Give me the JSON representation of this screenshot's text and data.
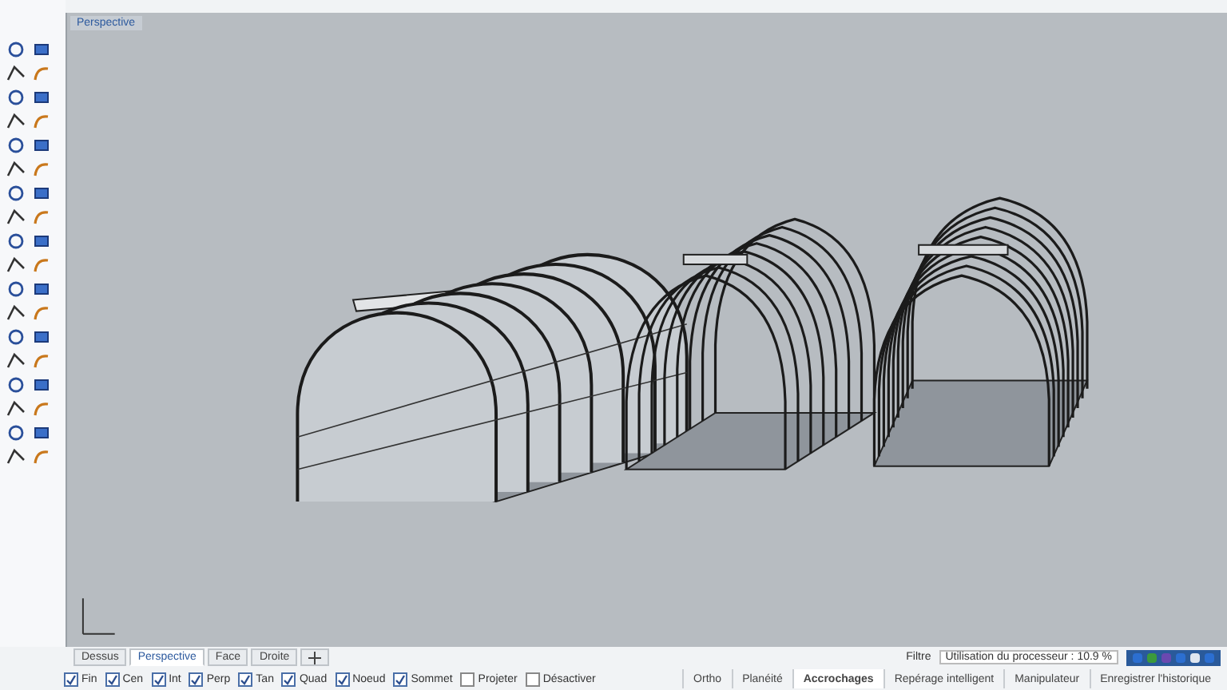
{
  "viewport": {
    "title": "Perspective"
  },
  "view_tabs": [
    {
      "label": "Dessus",
      "selected": false
    },
    {
      "label": "Perspective",
      "selected": true
    },
    {
      "label": "Face",
      "selected": false
    },
    {
      "label": "Droite",
      "selected": false
    }
  ],
  "osnaps": [
    {
      "label": "Fin",
      "checked": true
    },
    {
      "label": "Cen",
      "checked": true
    },
    {
      "label": "Int",
      "checked": true
    },
    {
      "label": "Perp",
      "checked": true
    },
    {
      "label": "Tan",
      "checked": true
    },
    {
      "label": "Quad",
      "checked": true
    },
    {
      "label": "Noeud",
      "checked": true
    },
    {
      "label": "Sommet",
      "checked": true
    },
    {
      "label": "Projeter",
      "checked": false
    },
    {
      "label": "Désactiver",
      "checked": false
    }
  ],
  "status_panes": [
    {
      "label": "Ortho",
      "selected": false
    },
    {
      "label": "Planéité",
      "selected": false
    },
    {
      "label": "Accrochages",
      "selected": true
    },
    {
      "label": "Repérage intelligent",
      "selected": false
    },
    {
      "label": "Manipulateur",
      "selected": false
    },
    {
      "label": "Enregistrer l'historique",
      "selected": false
    }
  ],
  "filter_label": "Filtre",
  "cpu_usage": "Utilisation du processeur : 10.9 %"
}
